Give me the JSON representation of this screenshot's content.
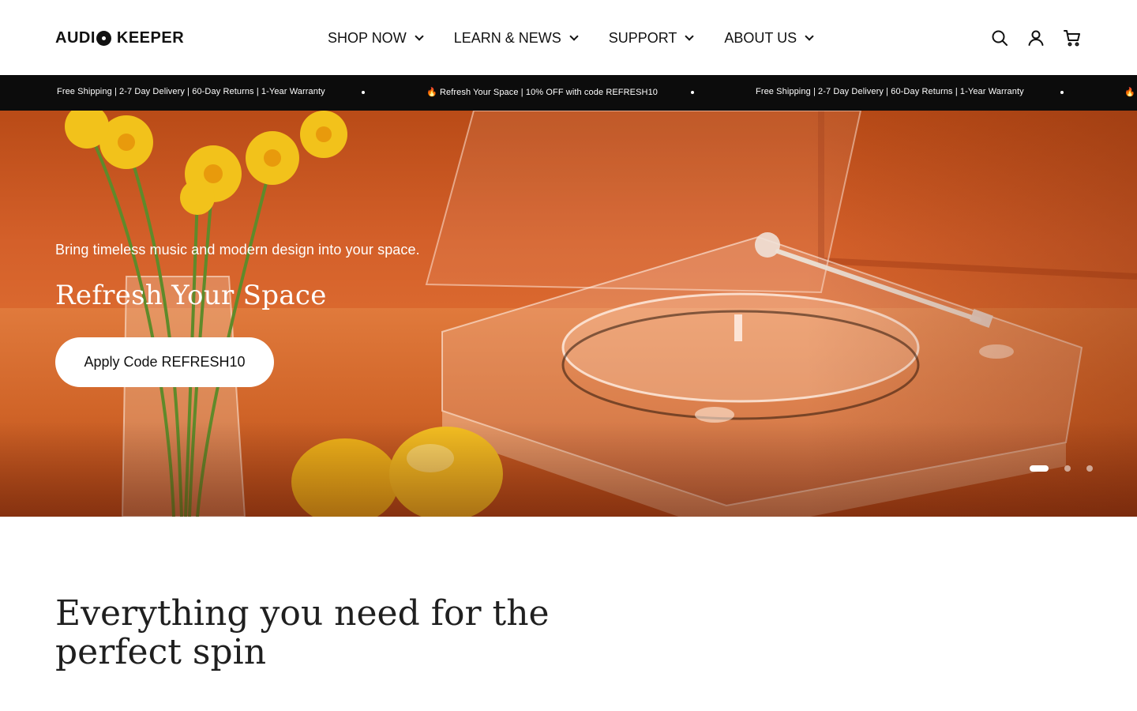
{
  "header": {
    "logo_text_left": "AUDI",
    "logo_text_right": "KEEPER",
    "nav": [
      {
        "label": "SHOP NOW"
      },
      {
        "label": "LEARN & NEWS"
      },
      {
        "label": "SUPPORT"
      },
      {
        "label": "ABOUT US"
      }
    ],
    "icons": [
      "search-icon",
      "account-icon",
      "cart-icon"
    ]
  },
  "announcement": {
    "messages": [
      "Free Shipping | 2-7 Day Delivery | 60-Day Returns | 1-Year Warranty",
      "🔥 Refresh Your Space | 10% OFF with code REFRESH10",
      "Free Shipping | 2-7 Day Delivery | 60-Day Returns | 1-Year Warranty",
      "🔥"
    ]
  },
  "hero": {
    "subtitle": "Bring timeless music and modern design into your space.",
    "title": "Refresh Your Space",
    "button_label": "Apply Code REFRESH10",
    "slides_total": 3,
    "active_slide": 1,
    "colors": {
      "background": "#d9652a",
      "flower": "#f2c21b",
      "lemon": "#f0b51a"
    }
  },
  "section": {
    "title": "Everything you need for the perfect spin"
  }
}
